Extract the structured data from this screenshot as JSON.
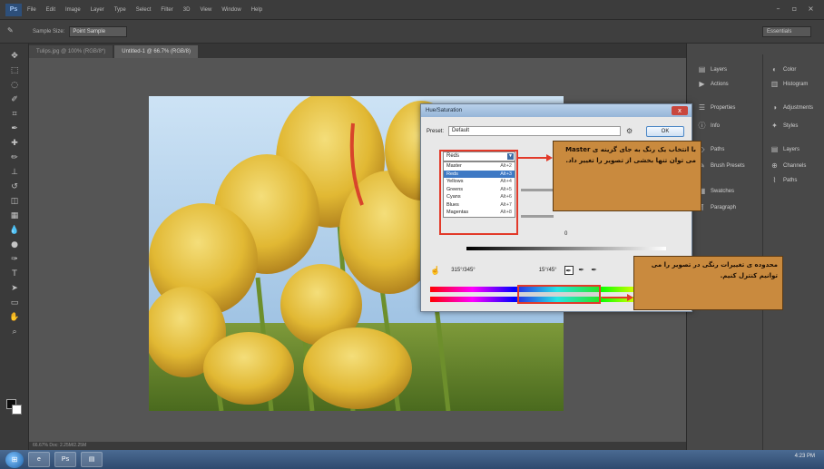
{
  "menubar": {
    "app_logo": "Ps",
    "items": [
      "File",
      "Edit",
      "Image",
      "Layer",
      "Type",
      "Select",
      "Filter",
      "3D",
      "View",
      "Window",
      "Help"
    ]
  },
  "optionsbar": {
    "label": "Sample Size:",
    "sample_value": "Point Sample",
    "workspace": "Essentials"
  },
  "document": {
    "tabs": [
      "Tulips.jpg @ 100% (RGB/8*)",
      "Untitled-1 @ 66.7% (RGB/8)"
    ],
    "status": "66.67%   Doc: 2.25M/2.25M"
  },
  "panels": {
    "left_col": [
      "Layers",
      "Actions",
      "Properties",
      "Info",
      "Paths",
      "Brush Presets",
      "Swatches",
      "Paragraph"
    ],
    "right_col": [
      "Color",
      "Histogram",
      "Adjustments",
      "Styles",
      "Layers",
      "Channels",
      "Paths"
    ]
  },
  "dialog": {
    "title": "Hue/Saturation",
    "close": "x",
    "preset_label": "Preset:",
    "preset_value": "Default",
    "ok_label": "OK",
    "channel_value": "Reds",
    "channels": [
      {
        "name": "Master",
        "shortcut": "Alt+2"
      },
      {
        "name": "Reds",
        "shortcut": "Alt+3"
      },
      {
        "name": "Yellows",
        "shortcut": "Alt+4"
      },
      {
        "name": "Greens",
        "shortcut": "Alt+5"
      },
      {
        "name": "Cyans",
        "shortcut": "Alt+6"
      },
      {
        "name": "Blues",
        "shortcut": "Alt+7"
      },
      {
        "name": "Magentas",
        "shortcut": "Alt+8"
      }
    ],
    "selected_channel_index": 1,
    "slider_value": "0",
    "range_left": "315°/345°",
    "range_right": "15°/45°"
  },
  "annotations": {
    "channel_note": "با انتخاب یک رنگ به جای گزینه ی Master می توان تنها بخشی از تصویر را تغییر داد.",
    "range_note": "محدوده ی تغییرات رنگی در تصویر را می توانیم کنترل کنیم."
  },
  "taskbar": {
    "apps": [
      "e",
      "Ps",
      "▤"
    ],
    "clock": "4:23 PM"
  },
  "colors": {
    "annotation_bg": "#c98a3e",
    "highlight_red": "#e23a2a",
    "selected_row": "#3e79c4"
  }
}
